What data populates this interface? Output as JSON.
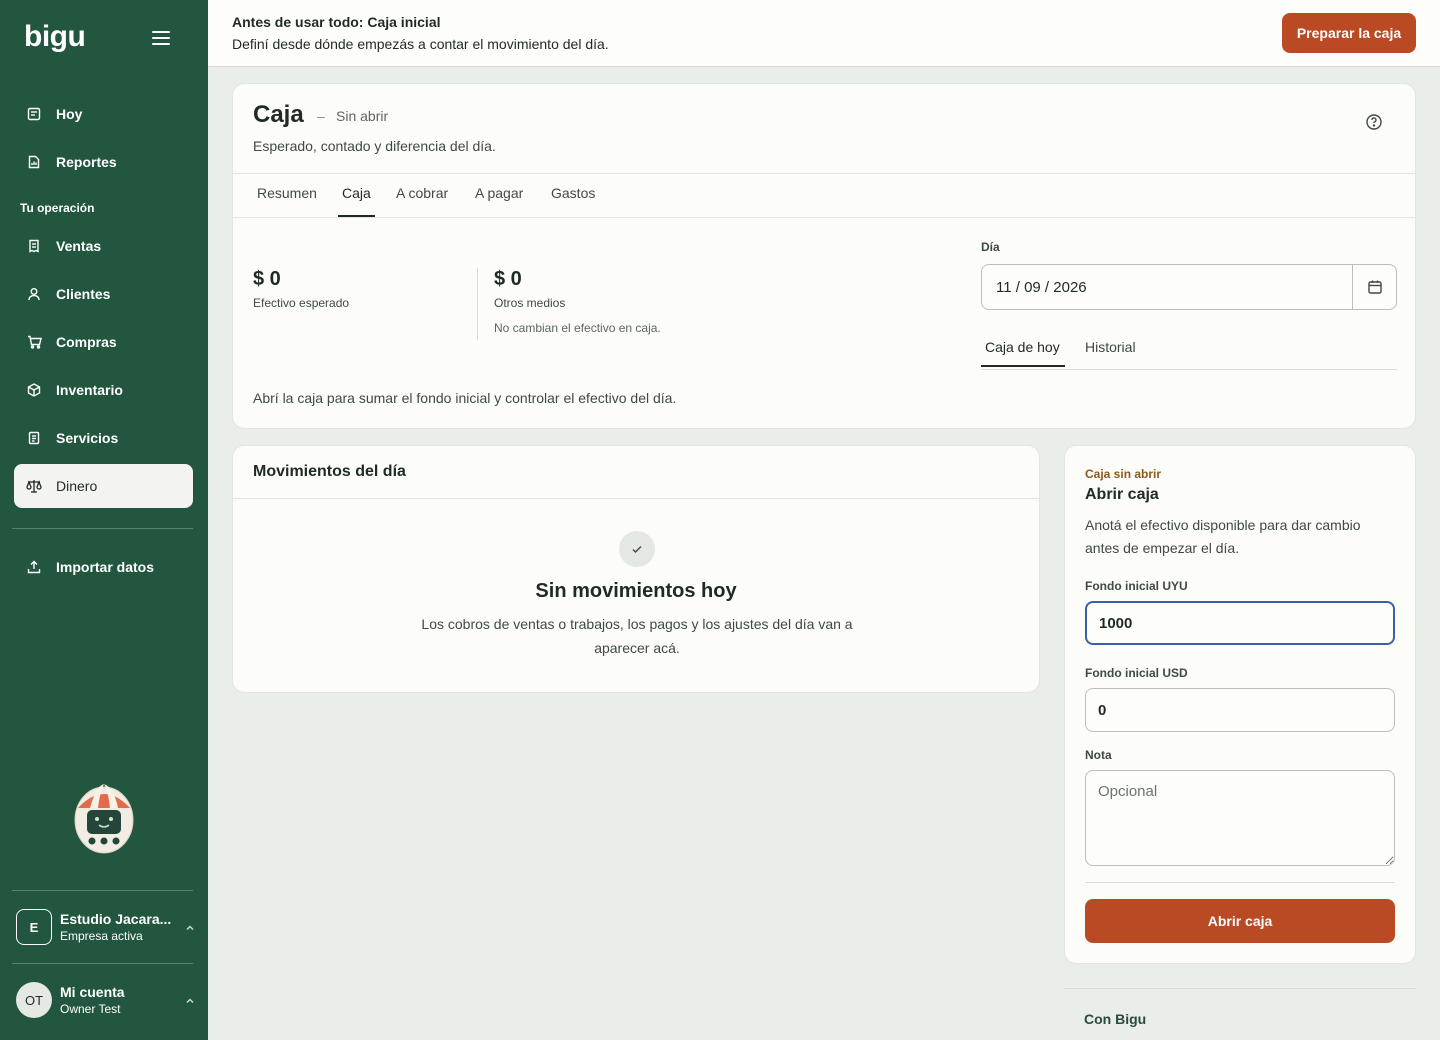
{
  "app": {
    "logo": "bigu"
  },
  "sidebar": {
    "menu_icon": "hamburger-icon",
    "items": [
      {
        "label": "Hoy",
        "icon": "calendar-icon"
      },
      {
        "label": "Reportes",
        "icon": "report-icon"
      }
    ],
    "section_label": "Tu operación",
    "operation_items": [
      {
        "label": "Ventas",
        "icon": "receipt-icon"
      },
      {
        "label": "Clientes",
        "icon": "user-icon"
      },
      {
        "label": "Compras",
        "icon": "cart-icon"
      },
      {
        "label": "Inventario",
        "icon": "box-icon"
      },
      {
        "label": "Servicios",
        "icon": "document-icon"
      },
      {
        "label": "Dinero",
        "icon": "scale-icon",
        "active": true
      }
    ],
    "import_label": "Importar datos",
    "company": {
      "initial": "E",
      "name": "Estudio Jacara...",
      "status": "Empresa activa"
    },
    "user": {
      "initials": "OT",
      "title": "Mi cuenta",
      "name": "Owner Test"
    }
  },
  "banner": {
    "title": "Antes de usar todo: Caja inicial",
    "text": "Definí desde dónde empezás a contar el movimiento del día.",
    "button": "Preparar la caja"
  },
  "caja": {
    "title": "Caja",
    "dash": "–",
    "status": "Sin abrir",
    "subtitle": "Esperado, contado y diferencia del día.",
    "tabs": [
      "Resumen",
      "Caja",
      "A cobrar",
      "A pagar",
      "Gastos"
    ],
    "active_tab": "Caja",
    "expected_cash": {
      "amount": "$ 0",
      "label": "Efectivo esperado"
    },
    "other_methods": {
      "amount": "$ 0",
      "label": "Otros medios",
      "note": "No cambian el efectivo en caja."
    },
    "day_label": "Día",
    "date_value": "11 / 09 / 2026",
    "subtabs": [
      "Caja de hoy",
      "Historial"
    ],
    "hint": "Abrí la caja para sumar el fondo inicial y controlar el efectivo del día."
  },
  "movimientos": {
    "title": "Movimientos del día",
    "empty_title": "Sin movimientos hoy",
    "empty_desc": "Los cobros de ventas o trabajos, los pagos y los ajustes del día van a aparecer acá."
  },
  "abrir": {
    "kicker": "Caja sin abrir",
    "title": "Abrir caja",
    "desc": "Anotá el efectivo disponible para dar cambio antes de empezar el día.",
    "uyu_label": "Fondo inicial UYU",
    "uyu_value": "1000",
    "usd_label": "Fondo inicial USD",
    "usd_value": "0",
    "note_label": "Nota",
    "note_placeholder": "Opcional",
    "button": "Abrir caja"
  },
  "con_bigu": {
    "title": "Con Bigu"
  },
  "colors": {
    "sidebar": "#23563f",
    "accent": "#b94a24",
    "active_item": "#f3f4ef"
  }
}
